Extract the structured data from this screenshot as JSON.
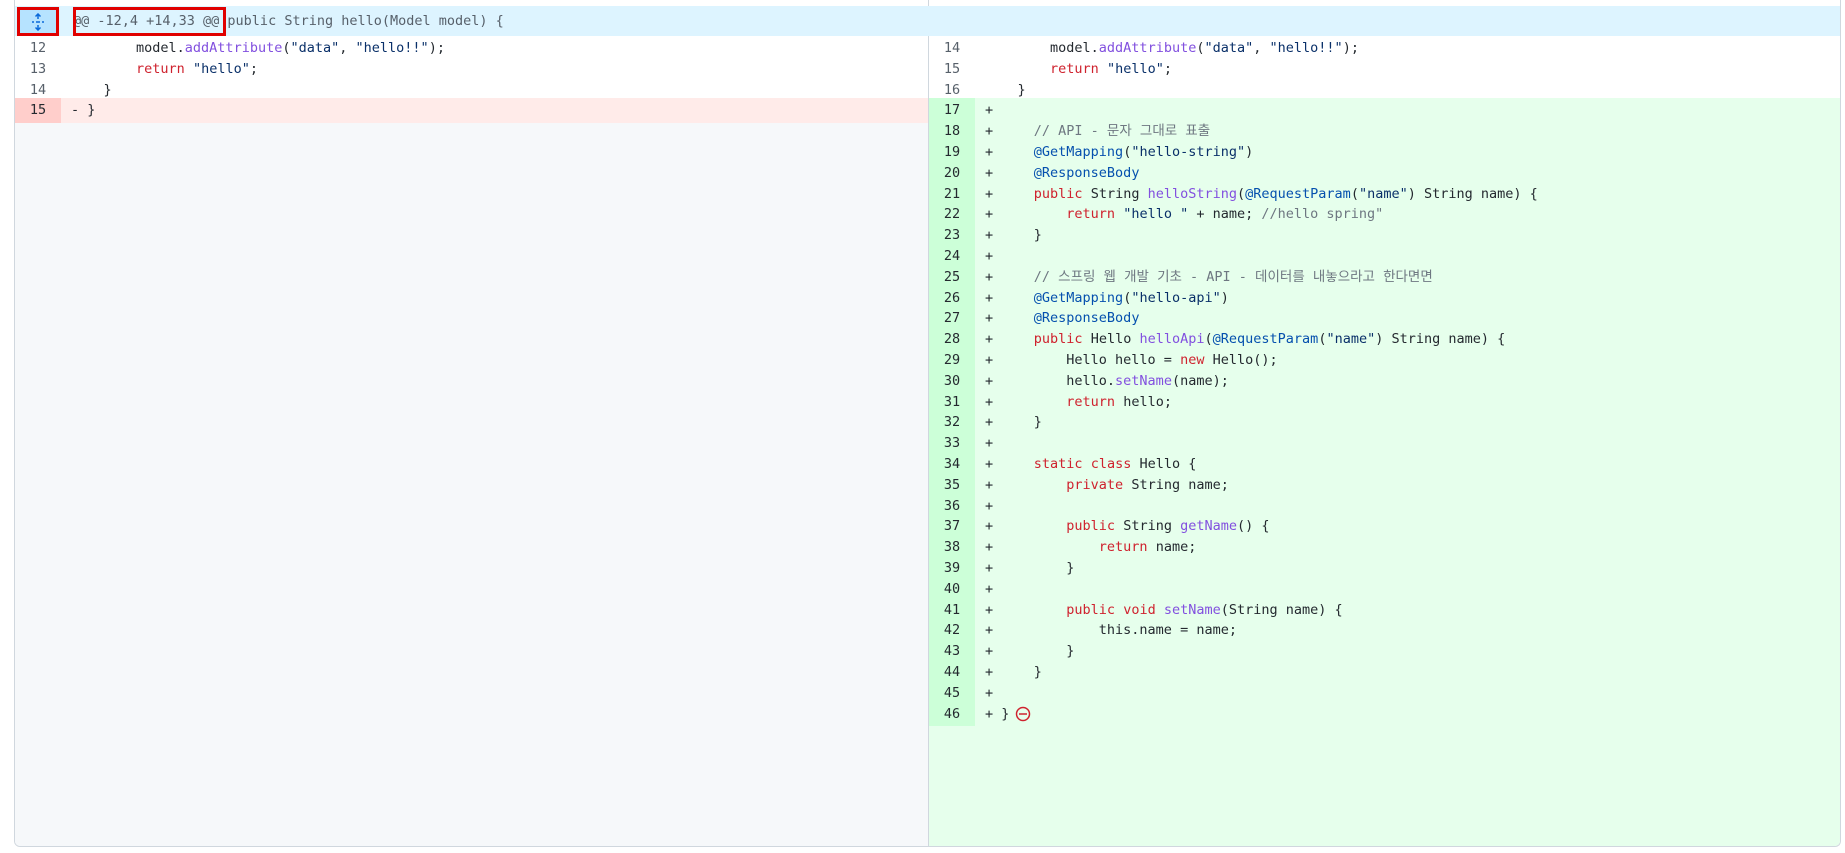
{
  "hunk": {
    "header": "@@ -12,4 +14,33 @@ public String hello(Model model) {",
    "expand_icon": "unfold-icon"
  },
  "colors": {
    "hunk_bg": "#ddf4ff",
    "deletion_bg": "#ffebe9",
    "addition_bg": "#e6ffec",
    "highlight_box": "#e00000"
  },
  "left": {
    "lines": [
      {
        "n": "12",
        "type": "ctx",
        "tokens": [
          [
            "        model.",
            ""
          ],
          [
            "addAttribute",
            "f"
          ],
          [
            "(",
            ""
          ],
          [
            "\"data\"",
            "s"
          ],
          [
            ", ",
            ""
          ],
          [
            "\"hello!!\"",
            "s"
          ],
          [
            ");",
            ""
          ]
        ]
      },
      {
        "n": "13",
        "type": "ctx",
        "tokens": [
          [
            "        ",
            ""
          ],
          [
            "return",
            "k"
          ],
          [
            " ",
            ""
          ],
          [
            "\"hello\"",
            "s"
          ],
          [
            ";",
            ""
          ]
        ]
      },
      {
        "n": "14",
        "type": "ctx",
        "tokens": [
          [
            "    }",
            ""
          ]
        ]
      },
      {
        "n": "15",
        "type": "del",
        "tokens": [
          [
            "- }",
            ""
          ]
        ]
      }
    ]
  },
  "right": {
    "lines": [
      {
        "n": "14",
        "type": "ctx",
        "tokens": [
          [
            "        model.",
            ""
          ],
          [
            "addAttribute",
            "f"
          ],
          [
            "(",
            ""
          ],
          [
            "\"data\"",
            "s"
          ],
          [
            ", ",
            ""
          ],
          [
            "\"hello!!\"",
            "s"
          ],
          [
            ");",
            ""
          ]
        ]
      },
      {
        "n": "15",
        "type": "ctx",
        "tokens": [
          [
            "        ",
            ""
          ],
          [
            "return",
            "k"
          ],
          [
            " ",
            ""
          ],
          [
            "\"hello\"",
            "s"
          ],
          [
            ";",
            ""
          ]
        ]
      },
      {
        "n": "16",
        "type": "ctx",
        "tokens": [
          [
            "    }",
            ""
          ]
        ]
      },
      {
        "n": "17",
        "type": "add",
        "tokens": [
          [
            "+",
            ""
          ]
        ]
      },
      {
        "n": "18",
        "type": "add",
        "tokens": [
          [
            "+     ",
            ""
          ],
          [
            "// API - 문자 그대로 표출",
            "c"
          ]
        ]
      },
      {
        "n": "19",
        "type": "add",
        "tokens": [
          [
            "+     ",
            ""
          ],
          [
            "@GetMapping",
            "a"
          ],
          [
            "(",
            ""
          ],
          [
            "\"hello-string\"",
            "s"
          ],
          [
            ")",
            ""
          ]
        ]
      },
      {
        "n": "20",
        "type": "add",
        "tokens": [
          [
            "+     ",
            ""
          ],
          [
            "@ResponseBody",
            "a"
          ]
        ]
      },
      {
        "n": "21",
        "type": "add",
        "tokens": [
          [
            "+     ",
            ""
          ],
          [
            "public",
            "k"
          ],
          [
            " String ",
            ""
          ],
          [
            "helloString",
            "f"
          ],
          [
            "(",
            ""
          ],
          [
            "@RequestParam",
            "a"
          ],
          [
            "(",
            ""
          ],
          [
            "\"name\"",
            "s"
          ],
          [
            ") String name) {",
            ""
          ]
        ]
      },
      {
        "n": "22",
        "type": "add",
        "tokens": [
          [
            "+         ",
            ""
          ],
          [
            "return",
            "k"
          ],
          [
            " ",
            ""
          ],
          [
            "\"hello \"",
            "s"
          ],
          [
            " + name; ",
            ""
          ],
          [
            "//hello spring\"",
            "c"
          ]
        ]
      },
      {
        "n": "23",
        "type": "add",
        "tokens": [
          [
            "+     }",
            ""
          ]
        ]
      },
      {
        "n": "24",
        "type": "add",
        "tokens": [
          [
            "+",
            ""
          ]
        ]
      },
      {
        "n": "25",
        "type": "add",
        "tokens": [
          [
            "+     ",
            ""
          ],
          [
            "// 스프링 웹 개발 기초 - API - 데이터를 내놓으라고 한다면면",
            "c"
          ]
        ]
      },
      {
        "n": "26",
        "type": "add",
        "tokens": [
          [
            "+     ",
            ""
          ],
          [
            "@GetMapping",
            "a"
          ],
          [
            "(",
            ""
          ],
          [
            "\"hello-api\"",
            "s"
          ],
          [
            ")",
            ""
          ]
        ]
      },
      {
        "n": "27",
        "type": "add",
        "tokens": [
          [
            "+     ",
            ""
          ],
          [
            "@ResponseBody",
            "a"
          ]
        ]
      },
      {
        "n": "28",
        "type": "add",
        "tokens": [
          [
            "+     ",
            ""
          ],
          [
            "public",
            "k"
          ],
          [
            " Hello ",
            ""
          ],
          [
            "helloApi",
            "f"
          ],
          [
            "(",
            ""
          ],
          [
            "@RequestParam",
            "a"
          ],
          [
            "(",
            ""
          ],
          [
            "\"name\"",
            "s"
          ],
          [
            ") String name) {",
            ""
          ]
        ]
      },
      {
        "n": "29",
        "type": "add",
        "tokens": [
          [
            "+         Hello hello = ",
            ""
          ],
          [
            "new",
            "k"
          ],
          [
            " Hello();",
            ""
          ]
        ]
      },
      {
        "n": "30",
        "type": "add",
        "tokens": [
          [
            "+         hello.",
            ""
          ],
          [
            "setName",
            "f"
          ],
          [
            "(name);",
            ""
          ]
        ]
      },
      {
        "n": "31",
        "type": "add",
        "tokens": [
          [
            "+         ",
            ""
          ],
          [
            "return",
            "k"
          ],
          [
            " hello;",
            ""
          ]
        ]
      },
      {
        "n": "32",
        "type": "add",
        "tokens": [
          [
            "+     }",
            ""
          ]
        ]
      },
      {
        "n": "33",
        "type": "add",
        "tokens": [
          [
            "+",
            ""
          ]
        ]
      },
      {
        "n": "34",
        "type": "add",
        "tokens": [
          [
            "+     ",
            ""
          ],
          [
            "static",
            "k"
          ],
          [
            " ",
            ""
          ],
          [
            "class",
            "k"
          ],
          [
            " Hello {",
            ""
          ]
        ]
      },
      {
        "n": "35",
        "type": "add",
        "tokens": [
          [
            "+         ",
            ""
          ],
          [
            "private",
            "k"
          ],
          [
            " String name;",
            ""
          ]
        ]
      },
      {
        "n": "36",
        "type": "add",
        "tokens": [
          [
            "+",
            ""
          ]
        ]
      },
      {
        "n": "37",
        "type": "add",
        "tokens": [
          [
            "+         ",
            ""
          ],
          [
            "public",
            "k"
          ],
          [
            " String ",
            ""
          ],
          [
            "getName",
            "f"
          ],
          [
            "() {",
            ""
          ]
        ]
      },
      {
        "n": "38",
        "type": "add",
        "tokens": [
          [
            "+             ",
            ""
          ],
          [
            "return",
            "k"
          ],
          [
            " name;",
            ""
          ]
        ]
      },
      {
        "n": "39",
        "type": "add",
        "tokens": [
          [
            "+         }",
            ""
          ]
        ]
      },
      {
        "n": "40",
        "type": "add",
        "tokens": [
          [
            "+",
            ""
          ]
        ]
      },
      {
        "n": "41",
        "type": "add",
        "tokens": [
          [
            "+         ",
            ""
          ],
          [
            "public",
            "k"
          ],
          [
            " ",
            ""
          ],
          [
            "void",
            "k"
          ],
          [
            " ",
            ""
          ],
          [
            "setName",
            "f"
          ],
          [
            "(String name) {",
            ""
          ]
        ]
      },
      {
        "n": "42",
        "type": "add",
        "tokens": [
          [
            "+             this.name = name;",
            ""
          ]
        ]
      },
      {
        "n": "43",
        "type": "add",
        "tokens": [
          [
            "+         }",
            ""
          ]
        ]
      },
      {
        "n": "44",
        "type": "add",
        "tokens": [
          [
            "+     }",
            ""
          ]
        ]
      },
      {
        "n": "45",
        "type": "add",
        "tokens": [
          [
            "+",
            ""
          ]
        ]
      },
      {
        "n": "46",
        "type": "add",
        "tokens": [
          [
            "+ }",
            ""
          ]
        ],
        "end_marker": "no-newline-icon"
      }
    ]
  }
}
